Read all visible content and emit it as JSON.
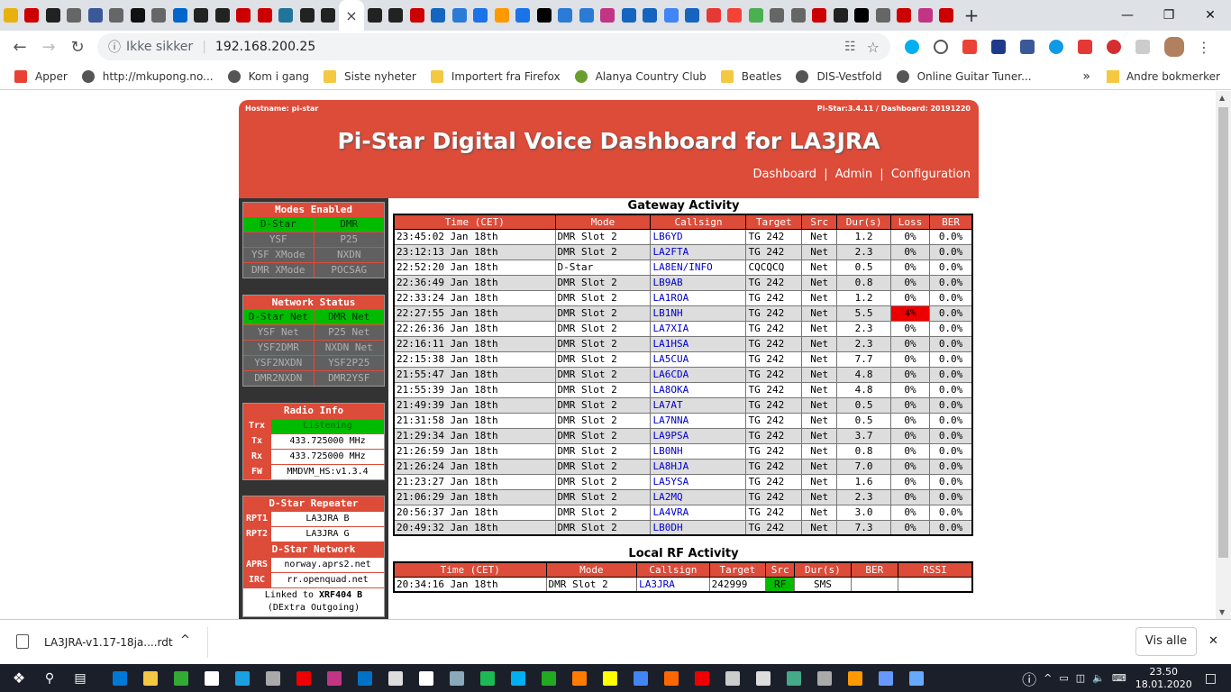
{
  "browser": {
    "address": {
      "security": "Ikke sikker",
      "url": "192.168.200.25"
    },
    "bookmarks": [
      {
        "label": "Apper",
        "icon": "apps-grid-icon"
      },
      {
        "label": "http://mkupong.no...",
        "icon": "globe-icon"
      },
      {
        "label": "Kom i gang",
        "icon": "globe-icon"
      },
      {
        "label": "Siste nyheter",
        "icon": "folder-icon"
      },
      {
        "label": "Importert fra Firefox",
        "icon": "folder-icon"
      },
      {
        "label": "Alanya Country Club",
        "icon": "golf-icon"
      },
      {
        "label": "Beatles",
        "icon": "folder-icon"
      },
      {
        "label": "DIS-Vestfold",
        "icon": "globe-icon"
      },
      {
        "label": "Online Guitar Tuner...",
        "icon": "globe-icon"
      }
    ],
    "more_bookmarks": "»",
    "other_bookmarks": "Andre bokmerker",
    "tab_icons": [
      "#e8b10e",
      "#c00",
      "#222",
      "#666",
      "#3b5998",
      "#666",
      "#111",
      "#666",
      "#0066cc",
      "#222",
      "#222",
      "#c00",
      "#c00",
      "#21759b",
      "#222",
      "#222"
    ],
    "tab_icons2": [
      "#222",
      "#222",
      "#c00",
      "#1565c0",
      "#2b7bd6",
      "#1a73e8",
      "#f90",
      "#1a73e8",
      "#000",
      "#2b7bd6",
      "#2b7bd6",
      "#c13584",
      "#1565c0",
      "#1565c0",
      "#4285f4",
      "#1565c0",
      "#e53935",
      "#f44336",
      "#4caf50",
      "#666",
      "#666",
      "#c00",
      "#222",
      "#000",
      "#666",
      "#c00",
      "#c13584",
      "#c00"
    ],
    "close_tab": "×",
    "new_tab": "+"
  },
  "dashboard": {
    "hostname": "Hostname: pi-star",
    "version": "Pi-Star:3.4.11 / Dashboard: 20191220",
    "title": "Pi-Star Digital Voice Dashboard for LA3JRA",
    "nav": [
      "Dashboard",
      "Admin",
      "Configuration"
    ],
    "nav_sep": "|",
    "modes": {
      "title": "Modes Enabled",
      "items": [
        {
          "label": "D-Star",
          "on": true
        },
        {
          "label": "DMR",
          "on": true
        },
        {
          "label": "YSF",
          "on": false
        },
        {
          "label": "P25",
          "on": false
        },
        {
          "label": "YSF XMode",
          "on": false
        },
        {
          "label": "NXDN",
          "on": false
        },
        {
          "label": "DMR XMode",
          "on": false
        },
        {
          "label": "POCSAG",
          "on": false
        }
      ]
    },
    "network": {
      "title": "Network Status",
      "items": [
        {
          "label": "D-Star Net",
          "on": true
        },
        {
          "label": "DMR Net",
          "on": true
        },
        {
          "label": "YSF Net",
          "on": false
        },
        {
          "label": "P25 Net",
          "on": false
        },
        {
          "label": "YSF2DMR",
          "on": false
        },
        {
          "label": "NXDN Net",
          "on": false
        },
        {
          "label": "YSF2NXDN",
          "on": false
        },
        {
          "label": "YSF2P25",
          "on": false
        },
        {
          "label": "DMR2NXDN",
          "on": false
        },
        {
          "label": "DMR2YSF",
          "on": false
        }
      ]
    },
    "radio": {
      "title": "Radio Info",
      "rows": [
        {
          "k": "Trx",
          "v": "Listening"
        },
        {
          "k": "Tx",
          "v": "433.725000 MHz"
        },
        {
          "k": "Rx",
          "v": "433.725000 MHz"
        },
        {
          "k": "FW",
          "v": "MMDVM_HS:v1.3.4"
        }
      ]
    },
    "dstar_repeater": {
      "title": "D-Star Repeater",
      "rows": [
        {
          "k": "RPT1",
          "v": "LA3JRA B"
        },
        {
          "k": "RPT2",
          "v": "LA3JRA G"
        }
      ]
    },
    "dstar_network": {
      "title": "D-Star Network",
      "rows": [
        {
          "k": "APRS",
          "v": "norway.aprs2.net"
        },
        {
          "k": "IRC",
          "v": "rr.openquad.net"
        }
      ],
      "linked_prefix": "Linked to",
      "linked_target": "XRF404 B",
      "linked_detail": "(DExtra Outgoing)"
    },
    "gateway": {
      "title": "Gateway Activity",
      "headers": [
        "Time (CET)",
        "Mode",
        "Callsign",
        "Target",
        "Src",
        "Dur(s)",
        "Loss",
        "BER"
      ],
      "rows": [
        [
          "23:45:02 Jan 18th",
          "DMR Slot 2",
          "LB6YD",
          "TG 242",
          "Net",
          "1.2",
          "0%",
          "0.0%"
        ],
        [
          "23:12:13 Jan 18th",
          "DMR Slot 2",
          "LA2FTA",
          "TG 242",
          "Net",
          "2.3",
          "0%",
          "0.0%"
        ],
        [
          "22:52:20 Jan 18th",
          "D-Star",
          "LA8EN/INFO",
          "CQCQCQ",
          "Net",
          "0.5",
          "0%",
          "0.0%"
        ],
        [
          "22:36:49 Jan 18th",
          "DMR Slot 2",
          "LB9AB",
          "TG 242",
          "Net",
          "0.8",
          "0%",
          "0.0%"
        ],
        [
          "22:33:24 Jan 18th",
          "DMR Slot 2",
          "LA1ROA",
          "TG 242",
          "Net",
          "1.2",
          "0%",
          "0.0%"
        ],
        [
          "22:27:55 Jan 18th",
          "DMR Slot 2",
          "LB1NH",
          "TG 242",
          "Net",
          "5.5",
          "4%",
          "0.0%"
        ],
        [
          "22:26:36 Jan 18th",
          "DMR Slot 2",
          "LA7XIA",
          "TG 242",
          "Net",
          "2.3",
          "0%",
          "0.0%"
        ],
        [
          "22:16:11 Jan 18th",
          "DMR Slot 2",
          "LA1HSA",
          "TG 242",
          "Net",
          "2.3",
          "0%",
          "0.0%"
        ],
        [
          "22:15:38 Jan 18th",
          "DMR Slot 2",
          "LA5CUA",
          "TG 242",
          "Net",
          "7.7",
          "0%",
          "0.0%"
        ],
        [
          "21:55:47 Jan 18th",
          "DMR Slot 2",
          "LA6CDA",
          "TG 242",
          "Net",
          "4.8",
          "0%",
          "0.0%"
        ],
        [
          "21:55:39 Jan 18th",
          "DMR Slot 2",
          "LA8OKA",
          "TG 242",
          "Net",
          "4.8",
          "0%",
          "0.0%"
        ],
        [
          "21:49:39 Jan 18th",
          "DMR Slot 2",
          "LA7AT",
          "TG 242",
          "Net",
          "0.5",
          "0%",
          "0.0%"
        ],
        [
          "21:31:58 Jan 18th",
          "DMR Slot 2",
          "LA7NNA",
          "TG 242",
          "Net",
          "0.5",
          "0%",
          "0.0%"
        ],
        [
          "21:29:34 Jan 18th",
          "DMR Slot 2",
          "LA9PSA",
          "TG 242",
          "Net",
          "3.7",
          "0%",
          "0.0%"
        ],
        [
          "21:26:59 Jan 18th",
          "DMR Slot 2",
          "LB0NH",
          "TG 242",
          "Net",
          "0.8",
          "0%",
          "0.0%"
        ],
        [
          "21:26:24 Jan 18th",
          "DMR Slot 2",
          "LA8HJA",
          "TG 242",
          "Net",
          "7.0",
          "0%",
          "0.0%"
        ],
        [
          "21:23:27 Jan 18th",
          "DMR Slot 2",
          "LA5YSA",
          "TG 242",
          "Net",
          "1.6",
          "0%",
          "0.0%"
        ],
        [
          "21:06:29 Jan 18th",
          "DMR Slot 2",
          "LA2MQ",
          "TG 242",
          "Net",
          "2.3",
          "0%",
          "0.0%"
        ],
        [
          "20:56:37 Jan 18th",
          "DMR Slot 2",
          "LA4VRA",
          "TG 242",
          "Net",
          "3.0",
          "0%",
          "0.0%"
        ],
        [
          "20:49:32 Jan 18th",
          "DMR Slot 2",
          "LB0DH",
          "TG 242",
          "Net",
          "7.3",
          "0%",
          "0.0%"
        ]
      ],
      "loss_alert_color": "#e00"
    },
    "local": {
      "title": "Local RF Activity",
      "headers": [
        "Time (CET)",
        "Mode",
        "Callsign",
        "Target",
        "Src",
        "Dur(s)",
        "BER",
        "RSSI"
      ],
      "rows": [
        [
          "20:34:16 Jan 18th",
          "DMR Slot 2",
          "LA3JRA",
          "242999",
          "RF",
          "SMS",
          "",
          ""
        ]
      ]
    },
    "colors": {
      "accent": "#dd4b39",
      "on": "#00bb00",
      "off": "#606060",
      "link": "#0000cc"
    }
  },
  "download": {
    "filename": "LA3JRA-v1.17-18ja....rdt",
    "show_all": "Vis alle",
    "close": "✕",
    "expand": "^"
  },
  "taskbar": {
    "time": "23.50",
    "date": "18.01.2020"
  }
}
